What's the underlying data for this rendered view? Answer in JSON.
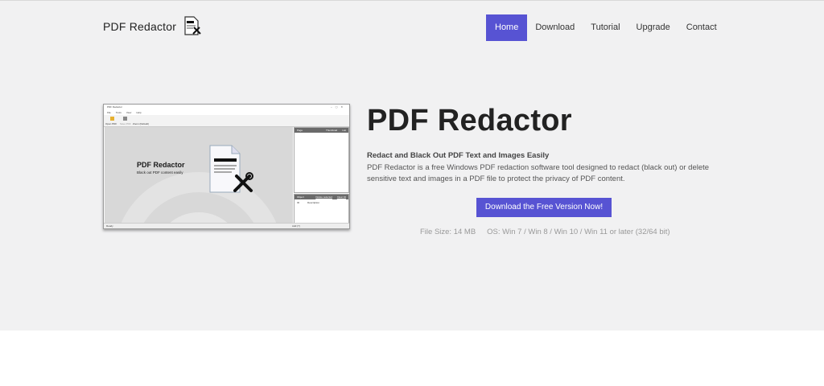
{
  "brand": {
    "name": "PDF Redactor",
    "logo_icon": "pdf-redactor-logo-icon"
  },
  "nav": {
    "items": [
      {
        "label": "Home",
        "active": true
      },
      {
        "label": "Download",
        "active": false
      },
      {
        "label": "Tutorial",
        "active": false
      },
      {
        "label": "Upgrade",
        "active": false
      },
      {
        "label": "Contact",
        "active": false
      }
    ]
  },
  "screenshot": {
    "window_title": "PDF Redactor",
    "menu": [
      "File",
      "Tools",
      "View",
      "Help"
    ],
    "ribbon": [
      "Open PDF",
      "Save PDF",
      "Zoom (Default)"
    ],
    "heading": "PDF Redactor",
    "subheading": "Black out PDF content easily",
    "page_panel_label": "Page",
    "page_panel_options": [
      "Thumbnail",
      "List"
    ],
    "object_panel_label": "Object",
    "object_panel_actions": [
      "Delete selected",
      "Clear All"
    ],
    "object_columns": [
      "ID",
      "Description"
    ],
    "status_left": "Ready",
    "status_right": "Add (?)"
  },
  "main": {
    "title": "PDF Redactor",
    "subtitle": "Redact and Black Out PDF Text and Images Easily",
    "description": "PDF Redactor is a free Windows PDF redaction software tool designed to redact (black out) or delete sensitive text and images in a PDF file to protect the privacy of PDF content.",
    "cta_label": "Download the Free Version Now!",
    "file_size": "File Size: 14 MB",
    "os": "OS: Win 7 / Win 8 / Win 10 / Win 11 or later (32/64 bit)"
  },
  "colors": {
    "accent": "#5753d3",
    "hero_bg": "#f1f1f2"
  }
}
